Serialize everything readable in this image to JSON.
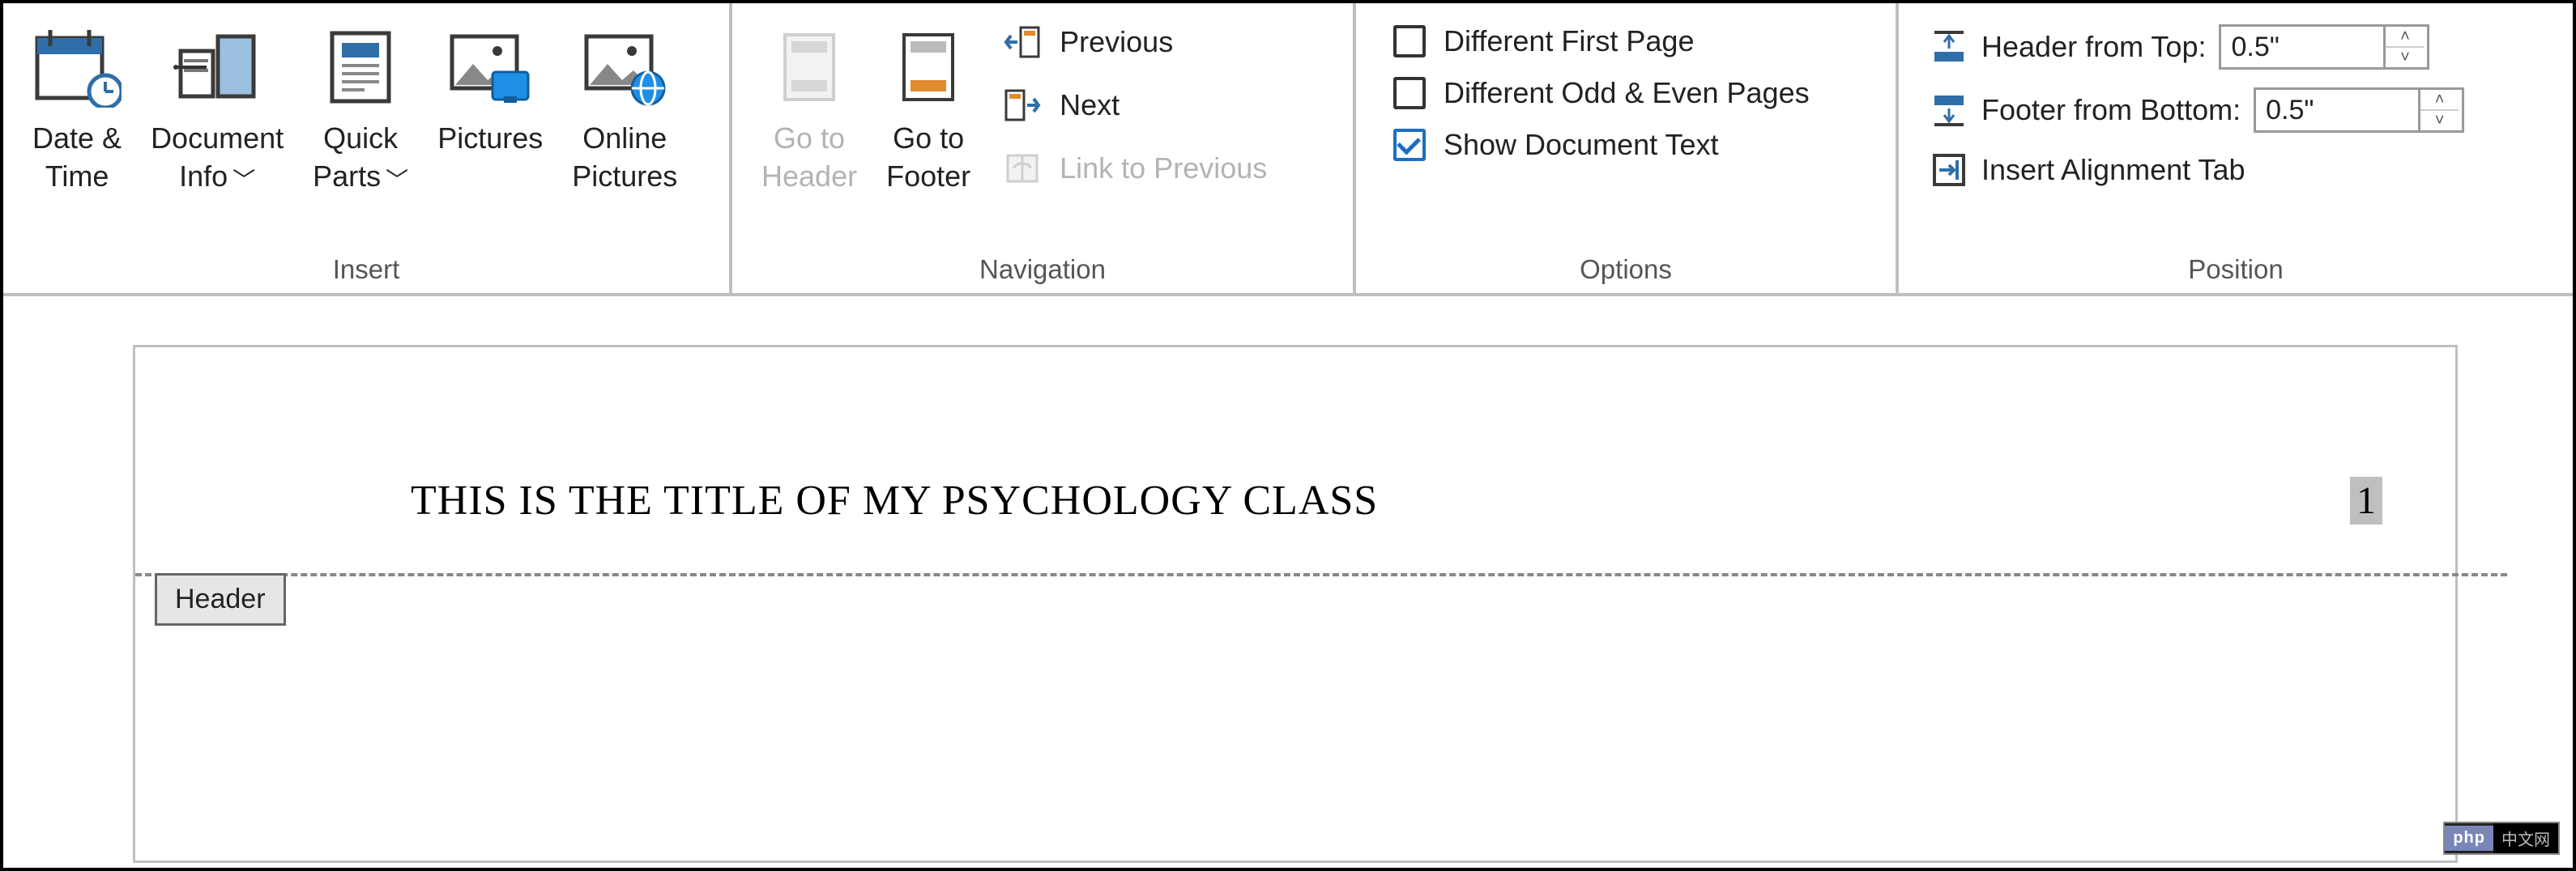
{
  "ribbon": {
    "groups": {
      "insert": {
        "label": "Insert",
        "date_time": "Date &\nTime",
        "doc_info": "Document\nInfo",
        "quick_parts": "Quick\nParts",
        "pictures": "Pictures",
        "online_pictures": "Online\nPictures"
      },
      "navigation": {
        "label": "Navigation",
        "go_to_header": "Go to\nHeader",
        "go_to_footer": "Go to\nFooter",
        "previous": "Previous",
        "next": "Next",
        "link_prev": "Link to Previous"
      },
      "options": {
        "label": "Options",
        "diff_first": {
          "label": "Different First Page",
          "checked": false
        },
        "diff_odd_even": {
          "label": "Different Odd & Even Pages",
          "checked": false
        },
        "show_doc_text": {
          "label": "Show Document Text",
          "checked": true
        }
      },
      "position": {
        "label": "Position",
        "header_top": {
          "label": "Header from Top:",
          "value": "0.5\""
        },
        "footer_bottom": {
          "label": "Footer from Bottom:",
          "value": "0.5\""
        },
        "alignment_tab": "Insert Alignment Tab"
      }
    }
  },
  "document": {
    "header_text": "THIS IS THE TITLE OF MY PSYCHOLOGY CLASS",
    "page_number": "1",
    "header_tab_label": "Header"
  },
  "badge": {
    "left": "php",
    "right": "中文网"
  }
}
